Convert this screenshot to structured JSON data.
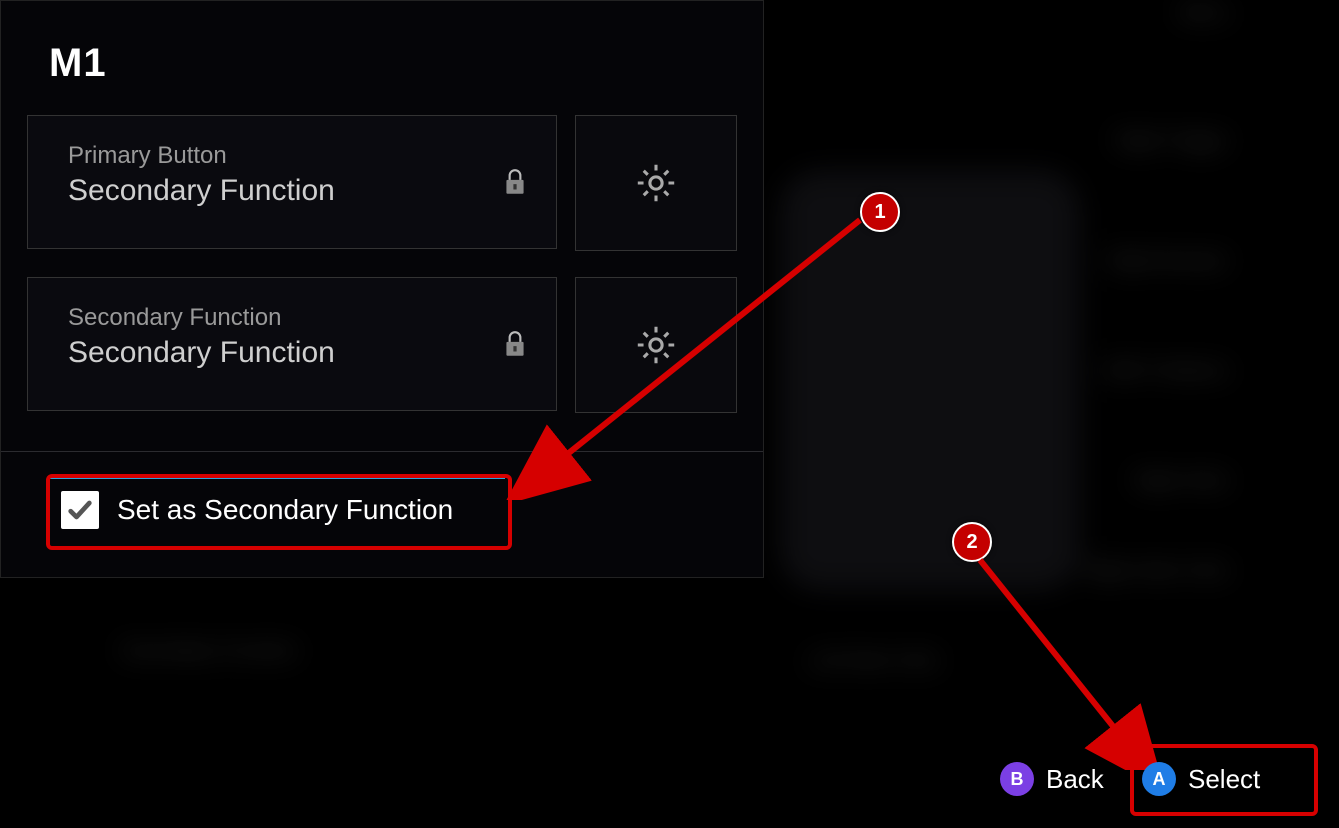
{
  "panel": {
    "title": "M1",
    "rows": [
      {
        "label": "Primary Button",
        "value": "Secondary Function"
      },
      {
        "label": "Secondary Function",
        "value": "Secondary Function"
      }
    ],
    "checkbox": {
      "label": "Set as Secondary Function",
      "checked": true
    }
  },
  "footer": {
    "back": {
      "glyph": "B",
      "label": "Back"
    },
    "select": {
      "glyph": "A",
      "label": "Select"
    }
  },
  "annotations": {
    "steps": [
      "1",
      "2"
    ]
  },
  "background_hints": {
    "right_list": [
      "Menu",
      "Right Trigger",
      "Right Bumper",
      "ABXY Buttons",
      "Right Stick",
      "Right Stick Click",
      "Left Stick Click"
    ],
    "bottom_left": "Secondary Function"
  }
}
